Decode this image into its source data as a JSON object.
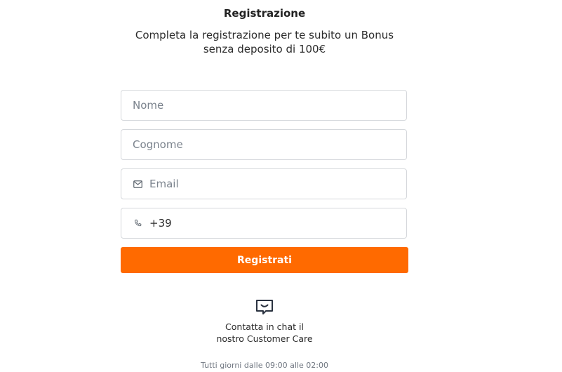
{
  "header": {
    "title": "Registrazione",
    "subtitle": "Completa la registrazione per te subito un Bonus senza deposito di 100€"
  },
  "form": {
    "nome": {
      "placeholder": "Nome",
      "value": ""
    },
    "cognome": {
      "placeholder": "Cognome",
      "value": ""
    },
    "email": {
      "placeholder": "Email",
      "value": "",
      "icon": "mail-icon"
    },
    "phone": {
      "placeholder": "",
      "value": "+39",
      "icon": "phone-icon"
    },
    "submit_label": "Registrati"
  },
  "support": {
    "icon": "chat-icon",
    "line1": "Contatta in chat il",
    "line2": "nostro Customer Care",
    "hours": "Tutti giorni dalle 09:00 alle 02:00"
  },
  "colors": {
    "accent": "#ff6a00",
    "border": "#d5d8dc",
    "text": "#2b2b2b"
  }
}
